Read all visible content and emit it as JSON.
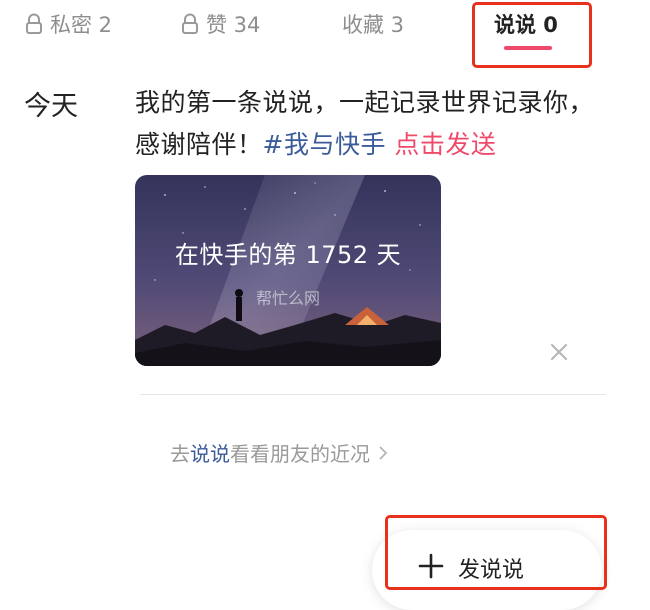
{
  "tabs": {
    "private": "私密 2",
    "likes": "赞 34",
    "favorites": "收藏 3",
    "shuoshuo": "说说 0"
  },
  "post": {
    "day": "今天",
    "text": "我的第一条说说，一起记录世界记录你，感谢陪伴！",
    "tag": "#我与快手",
    "send_link": "点击发送",
    "card_title": "在快手的第 1752 天",
    "card_watermark": "帮忙么网"
  },
  "friends_link": {
    "prefix": "去",
    "keyword": "说说",
    "suffix": "看看朋友的近况"
  },
  "fab": {
    "label": "发说说"
  },
  "icons": [
    "lock-icon",
    "close-icon",
    "chevron-right-icon",
    "plus-icon"
  ],
  "colors": {
    "accent": "#f04a6b",
    "tag": "#3b5b9a",
    "highlight": "#e8311d"
  }
}
